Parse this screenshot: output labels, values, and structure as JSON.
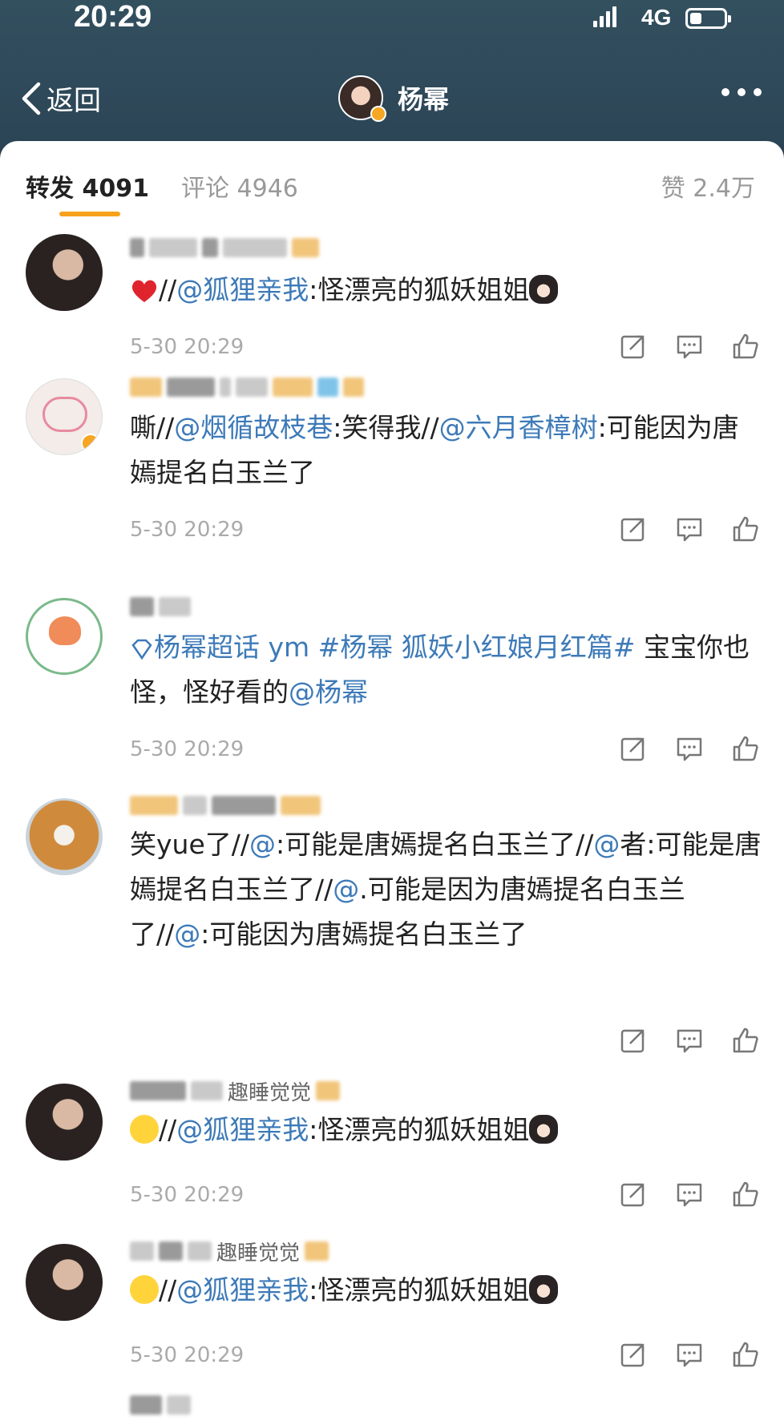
{
  "status_bar": {
    "time": "20:29",
    "network": "4G"
  },
  "nav": {
    "back_label": "返回",
    "title": "杨幂"
  },
  "tabs": {
    "repost": "转发 4091",
    "comment": "评论 4946",
    "like": "赞 2.4万"
  },
  "colors": {
    "accent": "#f7a21b",
    "mention": "#3d7ab8",
    "header": "#2c4556"
  },
  "items": [
    {
      "username": "",
      "segments": [
        {
          "t": "//"
        },
        {
          "t": "@狐狸亲我",
          "m": true
        },
        {
          "t": ":怪漂亮的狐妖姐姐"
        }
      ],
      "time": "5-30 20:29"
    },
    {
      "username": "",
      "segments": [
        {
          "t": "嘶//"
        },
        {
          "t": "@烟循故枝巷",
          "m": true
        },
        {
          "t": ":笑得我//"
        },
        {
          "t": "@六月香樟树",
          "m": true
        },
        {
          "t": ":可能因为唐嫣提名白玉兰了"
        }
      ],
      "time": "5-30 20:29"
    },
    {
      "username": "",
      "segments": [
        {
          "t": "杨幂超话 ym #杨幂 狐妖小红娘月红篇#",
          "m": true
        },
        {
          "t": " 宝宝你也怪，怪好看的"
        },
        {
          "t": "@杨幂",
          "m": true
        }
      ],
      "time": "5-30 20:29"
    },
    {
      "username": "",
      "segments": [
        {
          "t": "笑yue了//"
        },
        {
          "t": "@",
          "m": true
        },
        {
          "t": ":可能是唐嫣提名白玉兰了//"
        },
        {
          "t": "@",
          "m": true
        },
        {
          "t": "者:可能是唐嫣提名白玉兰了//"
        },
        {
          "t": "@",
          "m": true
        },
        {
          "t": ".可能是因为唐嫣提名白玉兰了//"
        },
        {
          "t": "@",
          "m": true
        },
        {
          "t": ":可能因为唐嫣提名白玉兰了"
        }
      ],
      "time": ""
    },
    {
      "username": "趣睡觉觉",
      "segments": [
        {
          "t": "//"
        },
        {
          "t": "@狐狸亲我",
          "m": true
        },
        {
          "t": ":怪漂亮的狐妖姐姐"
        }
      ],
      "time": "5-30 20:29"
    },
    {
      "username": "趣睡觉觉",
      "segments": [
        {
          "t": "//"
        },
        {
          "t": "@狐狸亲我",
          "m": true
        },
        {
          "t": ":怪漂亮的狐妖姐姐"
        }
      ],
      "time": "5-30 20:29"
    }
  ],
  "icons": [
    "back-chevron-icon",
    "more-icon",
    "share-icon",
    "comment-icon",
    "like-icon",
    "heart-emoji",
    "fox-emoji",
    "diamond-icon"
  ]
}
